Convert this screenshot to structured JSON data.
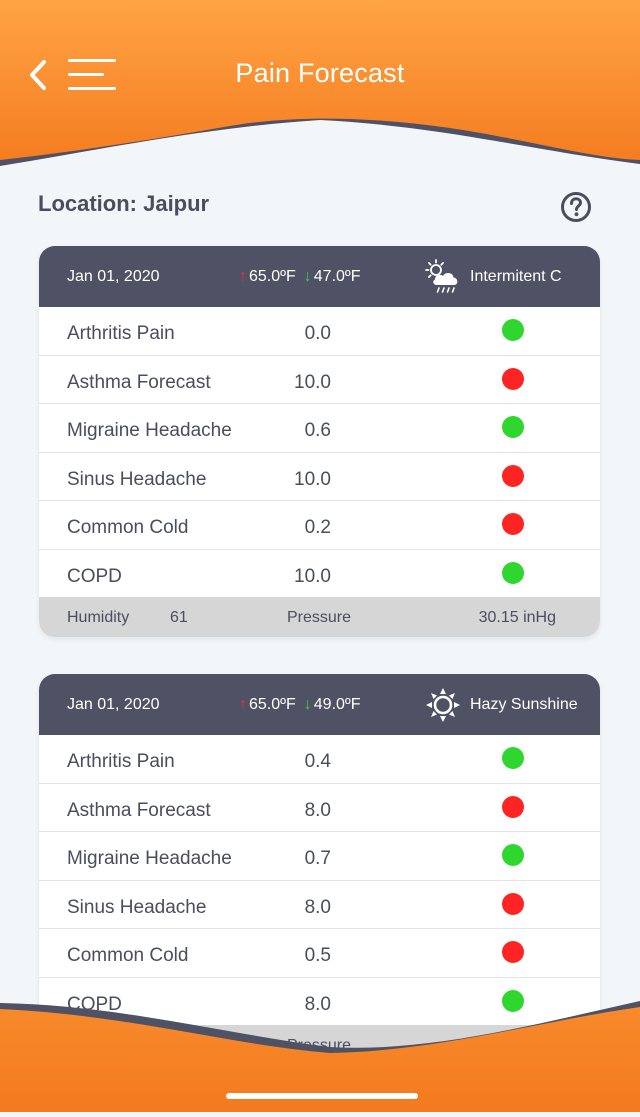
{
  "header": {
    "title": "Pain Forecast",
    "colors": {
      "orange_top": "#ffa444",
      "orange_bottom": "#f47a1f",
      "wave": "#4f5164"
    }
  },
  "location_label": "Location: Jaipur",
  "row_names": [
    "Arthritis Pain",
    "Asthma Forecast",
    "Migraine Headache",
    "Sinus Headache",
    "Common Cold",
    "COPD"
  ],
  "status_colors": {
    "green": "#2ed62e",
    "red": "#ff2424"
  },
  "cards": [
    {
      "date": "Jan 01, 2020",
      "high": "65.0ºF",
      "low": "47.0ºF",
      "weather_icon": "cloud-sun-rain-icon",
      "weather": "Intermitent C",
      "values": [
        "0.0",
        "10.0",
        "0.6",
        "10.0",
        "0.2",
        "10.0"
      ],
      "status": [
        "green",
        "red",
        "green",
        "red",
        "red",
        "green"
      ],
      "humidity_label": "Humidity",
      "humidity": "61",
      "pressure_label": "Pressure",
      "pressure": "30.15 inHg"
    },
    {
      "date": "Jan 01, 2020",
      "high": "65.0ºF",
      "low": "49.0ºF",
      "weather_icon": "sun-icon",
      "weather": "Hazy Sunshine",
      "values": [
        "0.4",
        "8.0",
        "0.7",
        "8.0",
        "0.5",
        "8.0"
      ],
      "status": [
        "green",
        "red",
        "green",
        "red",
        "red",
        "green"
      ],
      "pressure_label": "Pressure"
    }
  ]
}
